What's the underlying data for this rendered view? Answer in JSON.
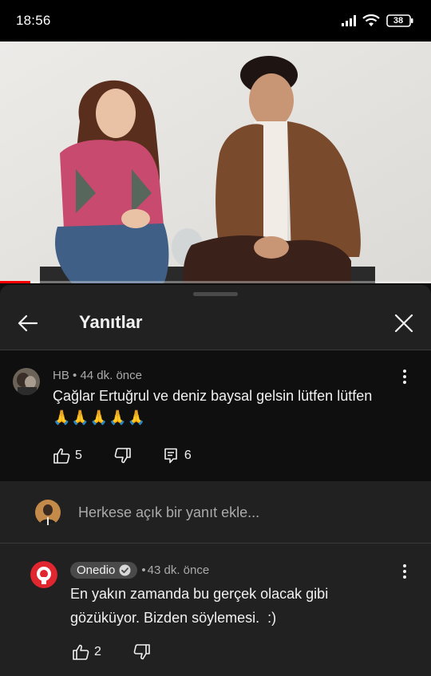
{
  "status_bar": {
    "time": "18:56",
    "battery": "38",
    "icons": [
      "signal-icon",
      "wifi-icon",
      "battery-icon"
    ]
  },
  "video": {
    "progress": 0.07,
    "progress_color": "#ff0000"
  },
  "sheet": {
    "title": "Yanıtlar",
    "back_icon": "arrow-left-icon",
    "close_icon": "close-icon"
  },
  "parent_comment": {
    "author": "HB",
    "time": "44 dk. önce",
    "text": "Çağlar Ertuğrul ve deniz baysal gelsin lütfen lütfen",
    "emoji": "🙏🙏🙏🙏🙏",
    "likes": "5",
    "replies": "6"
  },
  "reply_box": {
    "placeholder": "Herkese açık bir yanıt ekle..."
  },
  "reply": {
    "author": "Onedio",
    "verified": true,
    "time": "43 dk. önce",
    "text_line1": "En yakın zamanda bu gerçek olacak gibi",
    "text_line2": "gözüküyor. Bizden söylemesi.  :)",
    "likes": "2"
  },
  "colors": {
    "background": "#0f0f0f",
    "sheet": "#212121",
    "secondary_text": "#aaaaaa",
    "brand_onedio": "#e0262f"
  }
}
